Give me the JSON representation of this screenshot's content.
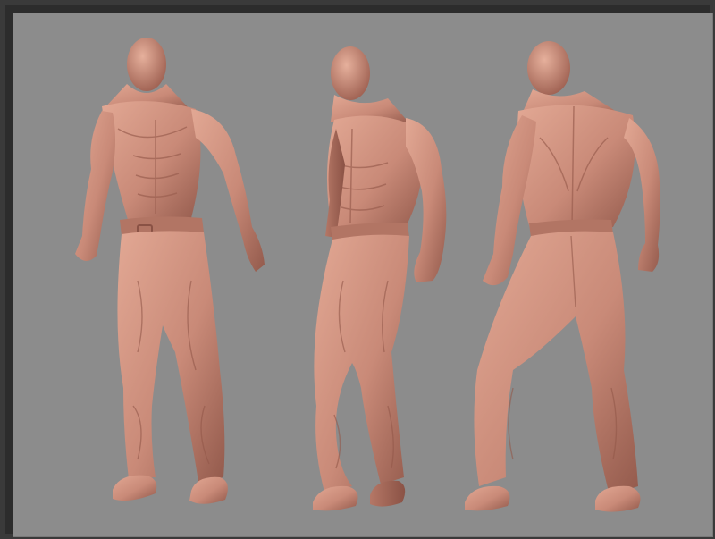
{
  "scene": {
    "background_color": "#8c8c8c",
    "frame_color": "#2f2f2f",
    "material_color": "#c98a78",
    "material_highlight": "#e3ab98",
    "material_shadow": "#8f5548",
    "views": [
      "front",
      "three-quarter",
      "back"
    ]
  }
}
